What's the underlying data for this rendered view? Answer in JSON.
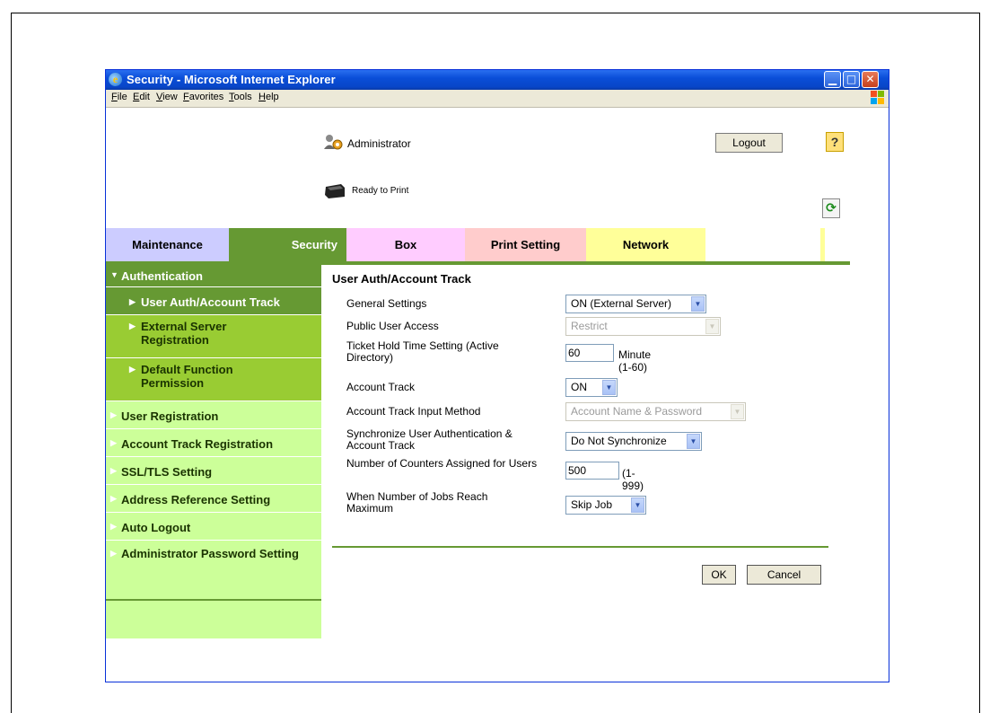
{
  "window": {
    "title": "Security - Microsoft Internet Explorer",
    "controls": {
      "minimize": "▁",
      "maximize": "□",
      "close": "✕"
    }
  },
  "menu": [
    "File",
    "Edit",
    "View",
    "Favorites",
    "Tools",
    "Help"
  ],
  "header": {
    "user": "Administrator",
    "logout_label": "Logout",
    "help_label": "?",
    "status": "Ready to Print",
    "refresh_label": "⟳"
  },
  "tabs": [
    {
      "label": "Maintenance",
      "color": "#ccccff"
    },
    {
      "label": "Security",
      "color": "#669933",
      "active": true
    },
    {
      "label": "Box",
      "color": "#ffccff"
    },
    {
      "label": "Print Setting",
      "color": "#ffcccc"
    },
    {
      "label": "Network",
      "color": "#ffff99"
    }
  ],
  "sidebar": {
    "items": [
      {
        "label": "Authentication",
        "icon": "triangle-down-icon",
        "expanded": true
      },
      {
        "label": "User Auth/Account Track",
        "icon": "triangle-right-icon",
        "selected": true
      },
      {
        "label": "External Server Registration",
        "icon": "triangle-right-icon"
      },
      {
        "label": "Default Function Permission",
        "icon": "triangle-right-icon"
      },
      {
        "label": "User Registration",
        "icon": "triangle-right-icon"
      },
      {
        "label": "Account Track Registration",
        "icon": "triangle-right-icon"
      },
      {
        "label": "SSL/TLS Setting",
        "icon": "triangle-right-icon"
      },
      {
        "label": "Address Reference Setting",
        "icon": "triangle-right-icon"
      },
      {
        "label": "Auto Logout",
        "icon": "triangle-right-icon"
      },
      {
        "label": "Administrator Password Setting",
        "icon": "triangle-right-icon"
      }
    ]
  },
  "main": {
    "title": "User Auth/Account Track",
    "rows": [
      {
        "label": "General Settings",
        "value": "ON (External Server)"
      },
      {
        "label": "Public User Access",
        "value": "Restrict",
        "disabled": true
      },
      {
        "label": "Ticket Hold Time Setting (Active Directory)",
        "value": "60",
        "unit": "Minute (1-60)"
      },
      {
        "label": "Account Track",
        "value": "ON"
      },
      {
        "label": "Account Track Input Method",
        "value": "Account Name & Password",
        "disabled": true
      },
      {
        "label": "Synchronize User Authentication & Account Track",
        "value": "Do Not Synchronize"
      },
      {
        "label": "Number of Counters Assigned for Users",
        "value": "500",
        "unit": "(1-999)"
      },
      {
        "label": "When Number of Jobs Reach Maximum",
        "value": "Skip Job"
      }
    ],
    "ok_label": "OK",
    "cancel_label": "Cancel"
  },
  "colors": {
    "accent": "#669933",
    "sidebar_bg": "#ccff99",
    "sidebar_sub": "#99cc33",
    "titlebar": "#0a4ed8"
  }
}
